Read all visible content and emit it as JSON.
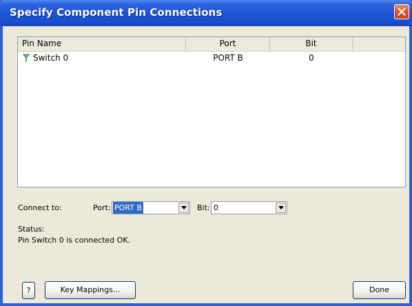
{
  "window": {
    "title": "Specify Component Pin Connections"
  },
  "list": {
    "columns": [
      "Pin Name",
      "Port",
      "Bit"
    ],
    "rows": [
      {
        "pin_name": "Switch 0",
        "port": "PORT B",
        "bit": "0"
      }
    ]
  },
  "connect": {
    "label": "Connect to:",
    "port_label": "Port:",
    "port_value": "PORT B",
    "bit_label": "Bit:",
    "bit_value": "0"
  },
  "status": {
    "label": "Status:",
    "message": "Pin Switch 0 is connected OK."
  },
  "buttons": {
    "help": "?",
    "key_mappings": "Key Mappings...",
    "done": "Done"
  },
  "colors": {
    "title_bar": "#1d55d6",
    "close_button": "#e0552f",
    "selection": "#316ac5",
    "pin_icon": "#2e8b57"
  },
  "icons": {
    "close": "close-icon",
    "pin": "pin-icon",
    "dropdown": "chevron-down-icon"
  }
}
